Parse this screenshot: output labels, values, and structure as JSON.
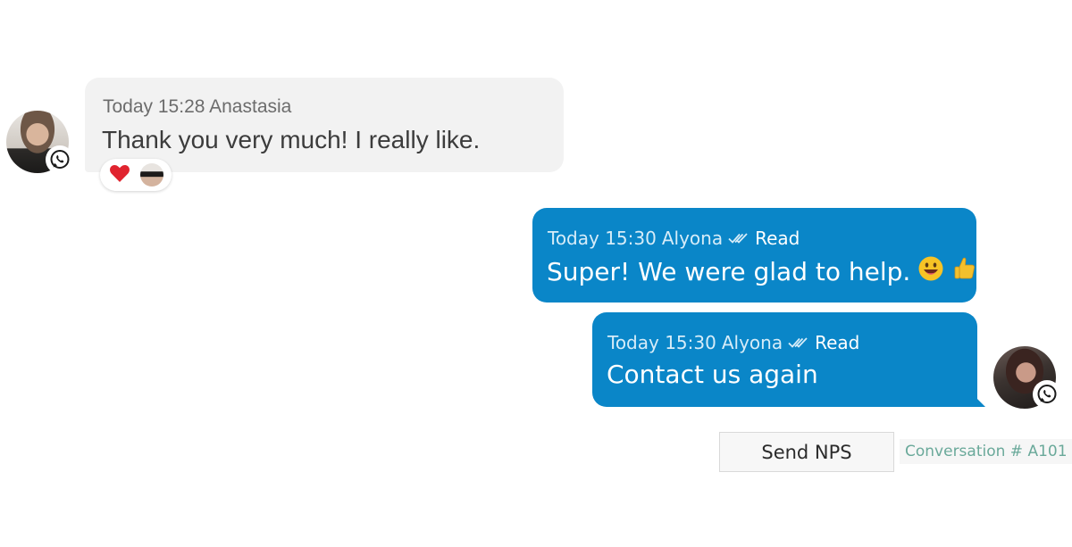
{
  "incoming": {
    "timestamp": "Today 15:28",
    "author": "Anastasia",
    "text": "Thank you very much! I really like.",
    "channel_icon": "whatsapp-icon",
    "reactions": [
      "heart",
      "user-avatar"
    ]
  },
  "outgoing": [
    {
      "timestamp": "Today 15:30",
      "author": "Alyona",
      "status": "Read",
      "text": "Super! We were glad to help.",
      "emojis": [
        "grinning-face",
        "thumbs-up"
      ]
    },
    {
      "timestamp": "Today 15:30",
      "author": "Alyona",
      "status": "Read",
      "text": "Contact us again",
      "channel_icon": "whatsapp-icon"
    }
  ],
  "actions": {
    "send_nps_label": "Send NPS"
  },
  "conversation": {
    "label": "Conversation # A101"
  },
  "colors": {
    "outgoing_bubble": "#0a86c8",
    "incoming_bubble": "#f2f2f2",
    "conversation_text": "#6aa99a"
  }
}
